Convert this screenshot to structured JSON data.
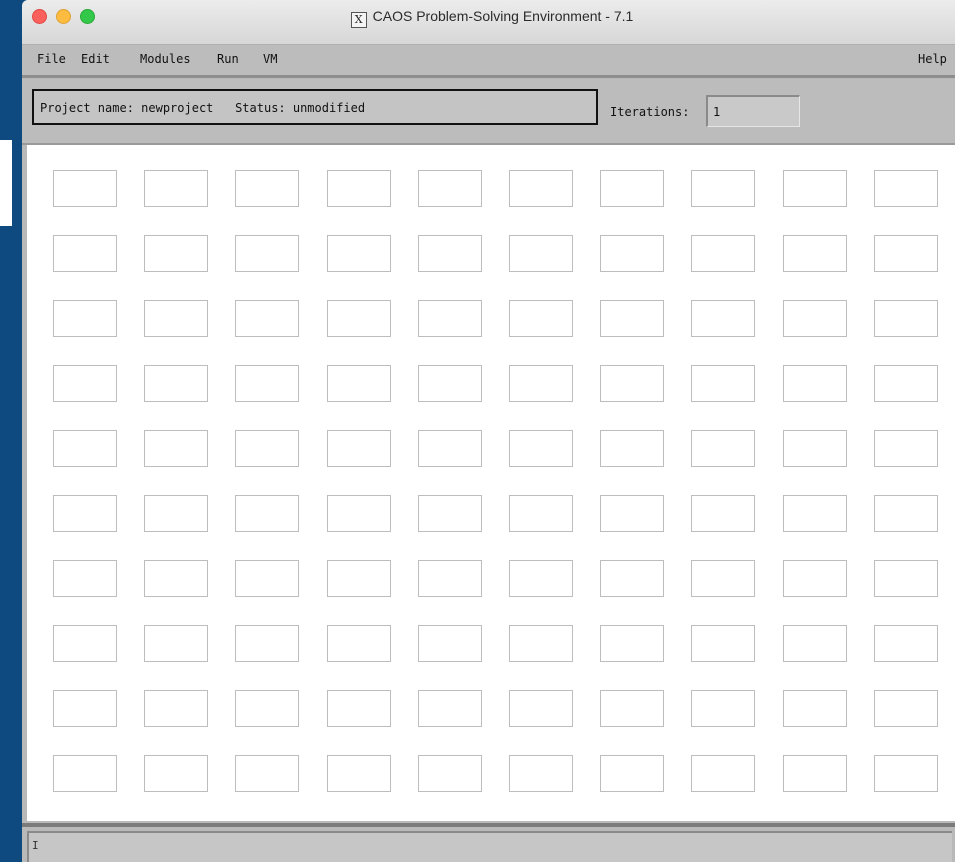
{
  "window": {
    "title": "CAOS Problem-Solving Environment - 7.1",
    "title_icon": "x11-icon",
    "title_icon_glyph": "X"
  },
  "menu": {
    "file": "File",
    "edit": "Edit",
    "modules": "Modules",
    "run": "Run",
    "vm": "VM",
    "help": "Help"
  },
  "status": {
    "project_line": "Project name: newproject   Status: unmodified",
    "iterations_label": "Iterations:",
    "iterations_value": "1"
  },
  "canvas": {
    "rows": 10,
    "cols": 10
  },
  "colors": {
    "desktop": "#0e4a80",
    "window_bg": "#b9b9b9",
    "canvas_bg": "#ffffff",
    "slot_border": "#bdbdbd"
  }
}
